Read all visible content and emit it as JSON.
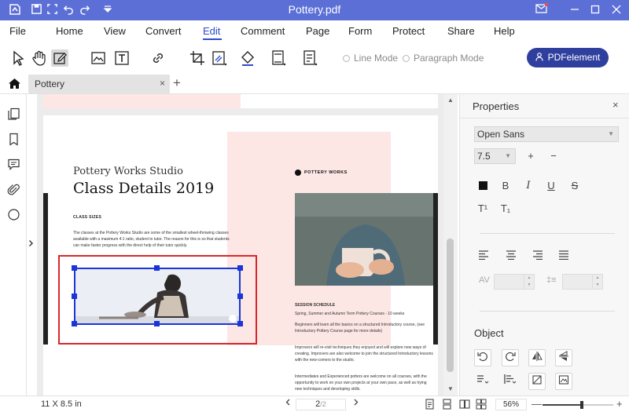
{
  "window": {
    "title": "Pottery.pdf"
  },
  "menu": {
    "items": [
      "File",
      "Home",
      "View",
      "Convert",
      "Edit",
      "Comment",
      "Page",
      "Form",
      "Protect",
      "Share",
      "Help"
    ],
    "active": "Edit"
  },
  "toolbar": {
    "line_mode": "Line Mode",
    "paragraph_mode": "Paragraph Mode",
    "pdfelement_button": "PDFelement"
  },
  "tabs": {
    "document_tab": "Pottery",
    "close": "×",
    "add": "+"
  },
  "document": {
    "studio_name": "Pottery Works Studio",
    "heading": "Class Details 2019",
    "class_sizes_label": "CLASS SIZES",
    "class_sizes_text": "The classes at the Pottery Works Studio are some of the smallest wheel-throwing classes available with a maximum 4:1 ratio, student to tutor. The reason for this is so that students can make faster progress with the direct help of their tutor quickly.",
    "logo_text": "POTTERY WORKS",
    "session_label": "SESSION SCHEDULE",
    "session_line": "Spring, Summer and Autumn Term Pottery Courses - 10 weeks",
    "beginners_text": "Beginners will learn all the basics on a structured Introductory course, (see Introductory Pottery Course page for more details)",
    "improvers_text": "Improvers will re-visit techniques they enjoyed and will explore new ways of creating. Improvers are also welcome to join the structured Introductory lessons with the new-comers to the studio.",
    "advanced_text": "Intermediates and Experienced potters are welcome on all courses, with the opportunity to work on your own projects at your own pace, as well as trying new techniques and developing skills."
  },
  "properties": {
    "title": "Properties",
    "close": "×",
    "font_family": "Open Sans",
    "font_size": "7.5",
    "increase": "+",
    "decrease": "−",
    "bold": "B",
    "italic": "I",
    "underline": "U",
    "strike": "S",
    "superscript": "T¹",
    "subscript": "T₁",
    "char_spacing_label": "AV",
    "line_spacing_label": "‡≡",
    "object_title": "Object"
  },
  "statusbar": {
    "page_size": "11 X 8.5 in",
    "current_page": "2",
    "total_pages": "/2",
    "zoom": "56%",
    "zoom_level": 0.56,
    "zoom_minus": "—",
    "zoom_plus": "+"
  },
  "colors": {
    "titlebar": "#5b6fd6",
    "accent": "#2f49c7",
    "selection_outline": "#d9262c",
    "selection_box": "#1c35d9",
    "pdfe_button": "#2f3f9e",
    "page_pink": "#fde7e5"
  }
}
